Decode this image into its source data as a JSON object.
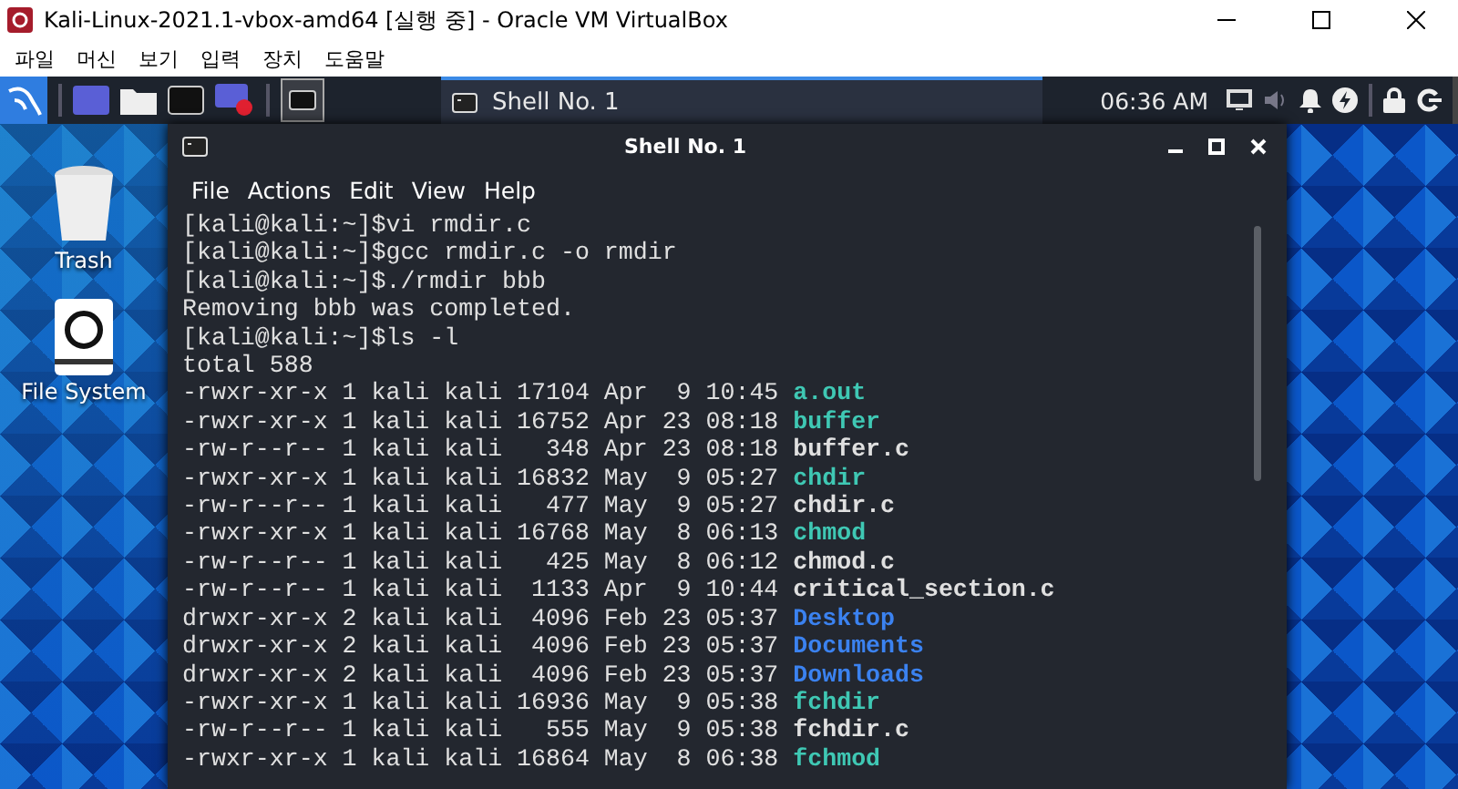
{
  "host_window": {
    "title": "Kali-Linux-2021.1-vbox-amd64 [실행 중] - Oracle VM VirtualBox"
  },
  "host_menu": [
    "파일",
    "머신",
    "보기",
    "입력",
    "장치",
    "도움말"
  ],
  "panel": {
    "task": {
      "label": "Shell No. 1",
      "selected": true
    },
    "clock": "06:36 AM"
  },
  "desktop_icons": [
    {
      "kind": "trash",
      "label": "Trash"
    },
    {
      "kind": "drive",
      "label": "File System"
    }
  ],
  "terminal": {
    "title": "Shell No. 1",
    "menu": [
      "File",
      "Actions",
      "Edit",
      "View",
      "Help"
    ],
    "lines": [
      {
        "kind": "text",
        "text": "[kali@kali:~]$vi rmdir.c"
      },
      {
        "kind": "text",
        "text": "[kali@kali:~]$gcc rmdir.c -o rmdir"
      },
      {
        "kind": "text",
        "text": "[kali@kali:~]$./rmdir bbb"
      },
      {
        "kind": "text",
        "text": "Removing bbb was completed."
      },
      {
        "kind": "text",
        "text": "[kali@kali:~]$ls -l"
      },
      {
        "kind": "text",
        "text": "total 588"
      },
      {
        "kind": "exec",
        "meta": "-rwxr-xr-x 1 kali kali 17104 Apr  9 10:45",
        "name": "a.out"
      },
      {
        "kind": "exec",
        "meta": "-rwxr-xr-x 1 kali kali 16752 Apr 23 08:18",
        "name": "buffer"
      },
      {
        "kind": "file",
        "meta": "-rw-r--r-- 1 kali kali   348 Apr 23 08:18",
        "name": "buffer.c"
      },
      {
        "kind": "exec",
        "meta": "-rwxr-xr-x 1 kali kali 16832 May  9 05:27",
        "name": "chdir"
      },
      {
        "kind": "file",
        "meta": "-rw-r--r-- 1 kali kali   477 May  9 05:27",
        "name": "chdir.c"
      },
      {
        "kind": "exec",
        "meta": "-rwxr-xr-x 1 kali kali 16768 May  8 06:13",
        "name": "chmod"
      },
      {
        "kind": "file",
        "meta": "-rw-r--r-- 1 kali kali   425 May  8 06:12",
        "name": "chmod.c"
      },
      {
        "kind": "file",
        "meta": "-rw-r--r-- 1 kali kali  1133 Apr  9 10:44",
        "name": "critical_section.c"
      },
      {
        "kind": "dir",
        "meta": "drwxr-xr-x 2 kali kali  4096 Feb 23 05:37",
        "name": "Desktop"
      },
      {
        "kind": "dir",
        "meta": "drwxr-xr-x 2 kali kali  4096 Feb 23 05:37",
        "name": "Documents"
      },
      {
        "kind": "dir",
        "meta": "drwxr-xr-x 2 kali kali  4096 Feb 23 05:37",
        "name": "Downloads"
      },
      {
        "kind": "exec",
        "meta": "-rwxr-xr-x 1 kali kali 16936 May  9 05:38",
        "name": "fchdir"
      },
      {
        "kind": "file",
        "meta": "-rw-r--r-- 1 kali kali   555 May  9 05:38",
        "name": "fchdir.c"
      },
      {
        "kind": "exec",
        "meta": "-rwxr-xr-x 1 kali kali 16864 May  8 06:38",
        "name": "fchmod"
      }
    ]
  }
}
